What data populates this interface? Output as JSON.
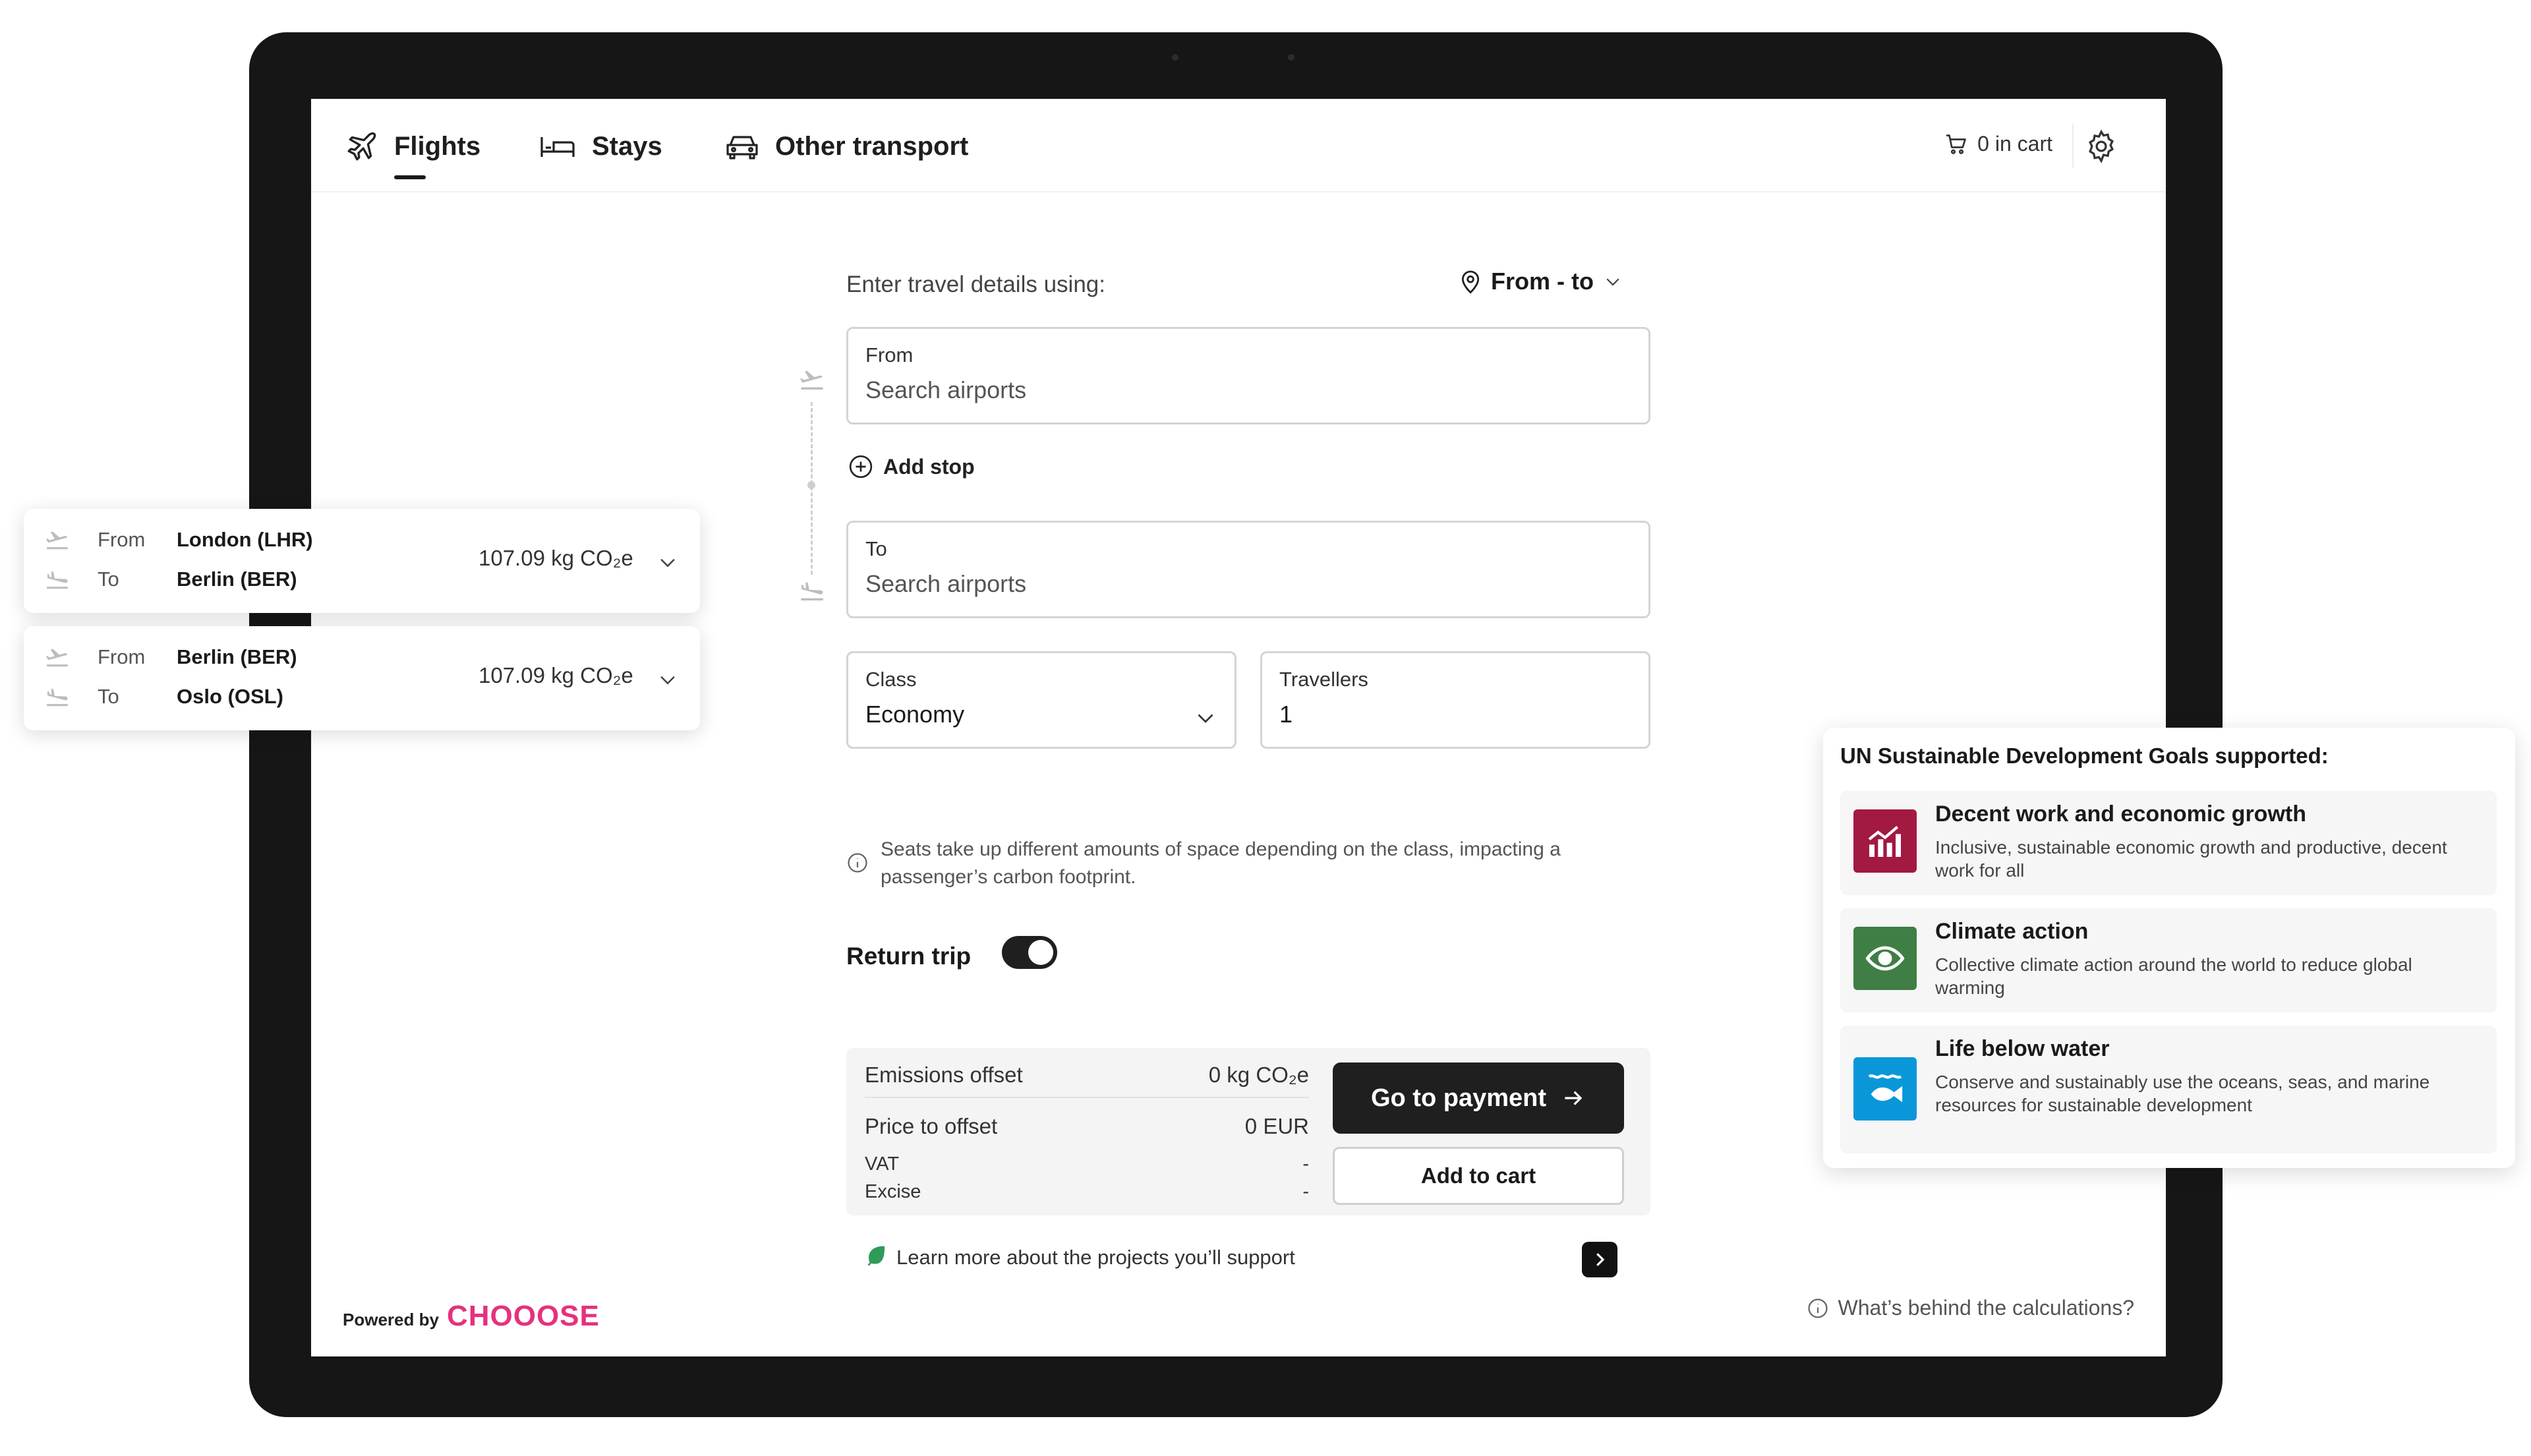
{
  "nav": {
    "tabs": [
      {
        "label": "Flights",
        "icon": "plane-icon",
        "active": true
      },
      {
        "label": "Stays",
        "icon": "bed-icon",
        "active": false
      },
      {
        "label": "Other transport",
        "icon": "car-icon",
        "active": false
      }
    ],
    "cart_label": "0 in cart"
  },
  "form": {
    "enter_label": "Enter travel details using:",
    "mode_label": "From - to",
    "from": {
      "caption": "From",
      "placeholder": "Search airports"
    },
    "add_stop": "Add stop",
    "to": {
      "caption": "To",
      "placeholder": "Search airports"
    },
    "class": {
      "caption": "Class",
      "value": "Economy"
    },
    "travellers": {
      "caption": "Travellers",
      "value": "1"
    },
    "class_note": "Seats take up different amounts of space depending on the class, impacting a passenger’s carbon footprint.",
    "return_trip_label": "Return trip",
    "return_trip_on": true
  },
  "summary": {
    "emissions_label": "Emissions offset",
    "emissions_value": "0 kg CO₂e",
    "price_label": "Price to offset",
    "price_value": "0 EUR",
    "vat_label": "VAT",
    "vat_value": "-",
    "excise_label": "Excise",
    "excise_value": "-",
    "pay_button": "Go to payment",
    "cart_button": "Add to cart"
  },
  "learn_more": "Learn more about the projects you’ll support",
  "footer": {
    "powered_by": "Powered by",
    "brand": "CHOOOSE",
    "calc_link": "What’s behind the calculations?"
  },
  "routes": [
    {
      "from_label": "From",
      "from": "London (LHR)",
      "to_label": "To",
      "to": "Berlin (BER)",
      "emissions": "107.09 kg CO₂e"
    },
    {
      "from_label": "From",
      "from": "Berlin (BER)",
      "to_label": "To",
      "to": "Oslo (OSL)",
      "emissions": "107.09 kg CO₂e"
    }
  ],
  "sdg": {
    "heading": "UN Sustainable Development Goals supported:",
    "goals": [
      {
        "title": "Decent work and economic growth",
        "desc": "Inclusive, sustainable economic growth and productive, decent work for all",
        "color": "#a21942",
        "icon": "growth-chart-icon"
      },
      {
        "title": "Climate action",
        "desc": "Collective climate action around the world to reduce global warming",
        "color": "#3f7e44",
        "icon": "eye-earth-icon"
      },
      {
        "title": "Life below water",
        "desc": "Conserve and sustainably use the oceans, seas, and marine resources for sustainable development",
        "color": "#0a97d9",
        "icon": "fish-icon"
      }
    ]
  }
}
